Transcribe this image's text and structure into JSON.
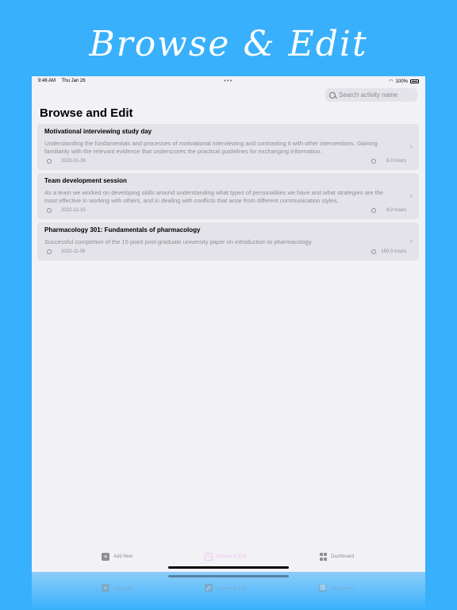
{
  "banner": {
    "title": "Browse & Edit"
  },
  "status_bar": {
    "time": "9:46 AM",
    "date": "Thu Jan 26",
    "dots": "•••",
    "battery": "100%"
  },
  "search": {
    "placeholder": "Search activity name"
  },
  "page": {
    "title": "Browse and Edit"
  },
  "activities": [
    {
      "title": "Motivational interviewing study day",
      "description": "Understanding the fundamentals and processes of motivational interviewing and contrasting it with other interventions. Gaining familiarity with the relevant evidence that underscores the practical guidelines for exchanging information.",
      "date": "2023-01-26",
      "hours": "6.0 hours"
    },
    {
      "title": "Team development session",
      "description": "As a team we worked on developing skills around understanding what types of personalities we have and what strategies are the most effective in working with others, and in dealing with conflicts that arise from different communication styles.",
      "date": "2022-12-15",
      "hours": "4.0 hours"
    },
    {
      "title": "Pharmacology 301:  Fundamentals of pharmacology",
      "description": "Successful completion of the 15 point post-graduate university paper on introduction to pharmacology.",
      "date": "2022-11-08",
      "hours": "150.0 hours"
    }
  ],
  "tabs": {
    "add_new": "Add New",
    "browse_edit": "Browse & Edit",
    "dashboard": "Dashboard"
  },
  "colors": {
    "background": "#39b0fb",
    "device_background": "#f2f1f6",
    "card": "#e4e3e9",
    "active_tab": "#f0c8ef",
    "secondary_text": "#8e8e93"
  },
  "icons": {
    "search": "search-icon",
    "calendar": "calendar-icon",
    "clock": "clock-icon",
    "chevron": "chevron-right-icon",
    "add": "plus-square-icon",
    "edit": "edit-square-icon",
    "dashboard": "grid-icon",
    "wifi": "wifi-icon",
    "battery": "battery-icon"
  }
}
